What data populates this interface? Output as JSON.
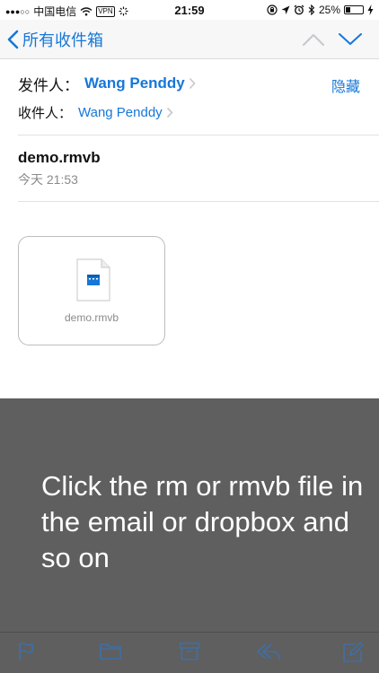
{
  "status_bar": {
    "signal_dots": "●●●○○",
    "carrier": "中国电信",
    "vpn": "VPN",
    "time": "21:59",
    "battery": "25%",
    "battery_fraction": 0.25
  },
  "nav": {
    "back_label": "所有收件箱"
  },
  "message": {
    "from_label": "发件人：",
    "from_name": "Wang Penddy",
    "hide_label": "隐藏",
    "to_label": "收件人：",
    "to_name": "Wang Penddy",
    "subject": "demo.rmvb",
    "date": "今天 21:53"
  },
  "attachment": {
    "name": "demo.rmvb"
  },
  "overlay": {
    "text": "Click the rm or rmvb file in the email or dropbox and so on"
  },
  "icons": {
    "flag": "flag-icon",
    "folder": "folder-icon",
    "archive": "archive-icon",
    "reply": "reply-icon",
    "compose": "compose-icon"
  },
  "colors": {
    "accent": "#1677d9",
    "overlay": "#5f5f5f"
  }
}
